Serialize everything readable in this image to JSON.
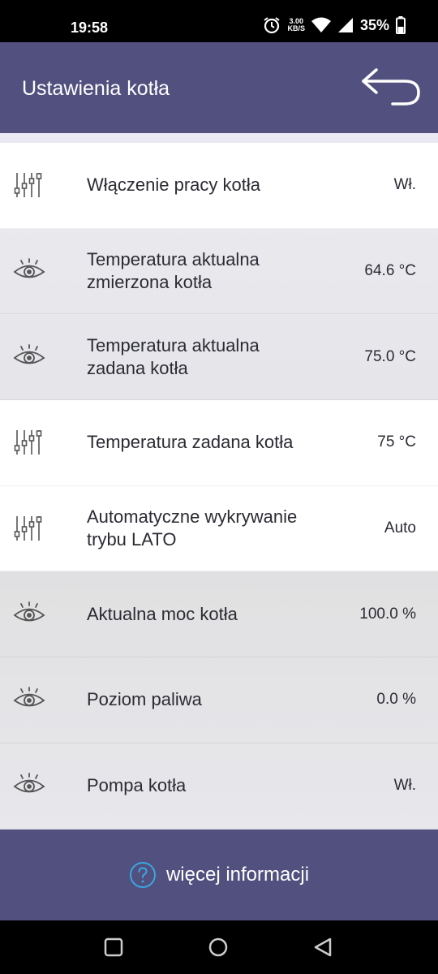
{
  "status_bar": {
    "time": "19:58",
    "speed_top": "3.00",
    "speed_bottom": "KB/S",
    "battery": "35%"
  },
  "header": {
    "title": "Ustawienia kotła"
  },
  "rows": [
    {
      "icon": "sliders-icon",
      "label": "Włączenie pracy kotła",
      "value": "Wł.",
      "style": "white"
    },
    {
      "icon": "eye-icon",
      "label": "Temperatura aktualna\nzmierzona kotła",
      "value": "64.6 °C",
      "style": "blur"
    },
    {
      "icon": "eye-icon",
      "label": "Temperatura aktualna\nzadana kotła",
      "value": "75.0 °C",
      "style": "blur"
    },
    {
      "icon": "sliders-icon",
      "label": "Temperatura zadana kotła",
      "value": "75 °C",
      "style": "white"
    },
    {
      "icon": "sliders-icon",
      "label": "Automatyczne wykrywanie\ntrybu LATO",
      "value": "Auto",
      "style": "white"
    },
    {
      "icon": "eye-icon",
      "label": "Aktualna moc kotła",
      "value": "100.0 %",
      "style": "blur"
    },
    {
      "icon": "eye-icon",
      "label": "Poziom paliwa",
      "value": "0.0 %",
      "style": "blur"
    },
    {
      "icon": "eye-icon",
      "label": "Pompa kotła",
      "value": "Wł.",
      "style": "blur"
    }
  ],
  "footer": {
    "label": "więcej informacji",
    "icon": "help-circle-icon"
  },
  "colors": {
    "accent": "#52507e",
    "help_icon": "#3aa6e0"
  }
}
